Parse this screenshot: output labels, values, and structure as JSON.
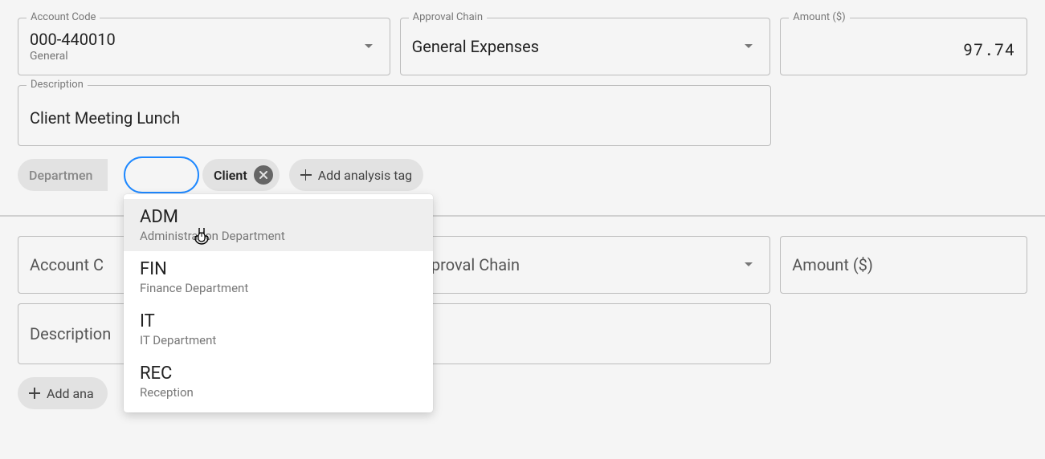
{
  "row1": {
    "account": {
      "label": "Account Code",
      "code": "000-440010",
      "name": "General"
    },
    "approval": {
      "label": "Approval Chain",
      "value": "General Expenses"
    },
    "amount": {
      "label": "Amount ($)",
      "value": "97.74"
    },
    "description": {
      "label": "Description",
      "value": "Client Meeting Lunch"
    }
  },
  "tags": {
    "department_label": "Departmen",
    "client_label": "Client",
    "add_tag_label": "Add analysis tag"
  },
  "dropdown": {
    "items": [
      {
        "code": "ADM",
        "name": "Administration Department"
      },
      {
        "code": "FIN",
        "name": "Finance Department"
      },
      {
        "code": "IT",
        "name": "IT Department"
      },
      {
        "code": "REC",
        "name": "Reception"
      }
    ]
  },
  "row2": {
    "account_label": "Account C",
    "approval_label": "Approval Chain",
    "amount_label": "Amount ($)",
    "description_label": "Description",
    "add_tag_label": "Add ana"
  }
}
